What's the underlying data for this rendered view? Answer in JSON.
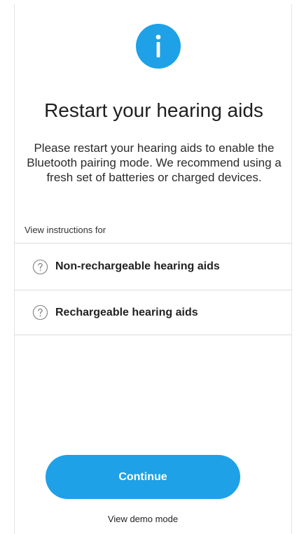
{
  "header": {
    "icon": "info-icon",
    "title": "Restart your hearing aids",
    "message": "Please restart your hearing aids to enable the Bluetooth pairing mode. We recommend using a fresh set of batteries or charged devices."
  },
  "instructions": {
    "label": "View instructions for",
    "items": [
      {
        "icon": "help-circle-icon",
        "label": "Non-rechargeable hearing aids"
      },
      {
        "icon": "help-circle-icon",
        "label": "Rechargeable hearing aids"
      }
    ]
  },
  "actions": {
    "continue_label": "Continue",
    "demo_label": "View demo mode"
  },
  "colors": {
    "accent": "#1ea1e6",
    "divider": "#dcdcdc",
    "text": "#1f1f1f"
  }
}
